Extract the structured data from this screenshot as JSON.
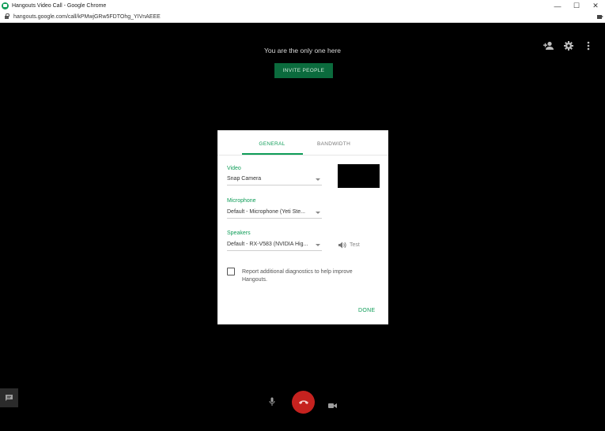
{
  "window": {
    "title": "Hangouts Video Call - Google Chrome",
    "url": "hangouts.google.com/call/kPMwjGRw5FDTOhg_YIVnAEEE",
    "minimize": "—",
    "maximize": "☐",
    "close": "✕"
  },
  "call": {
    "status": "You are the only one here",
    "invite_label": "INVITE PEOPLE"
  },
  "dialog": {
    "tabs": [
      "GENERAL",
      "BANDWIDTH"
    ],
    "active_tab": "GENERAL",
    "video": {
      "label": "Video",
      "value": "Snap Camera"
    },
    "microphone": {
      "label": "Microphone",
      "value": "Default - Microphone (Yeti Ste..."
    },
    "speakers": {
      "label": "Speakers",
      "value": "Default - RX-V583 (NVIDIA Hig...",
      "test_label": "Test"
    },
    "diagnostics": {
      "label": "Report additional diagnostics to help improve Hangouts.",
      "checked": false
    },
    "done_label": "DONE"
  },
  "colors": {
    "accent": "#0f9d58",
    "hangup": "#c5221f",
    "invite_bg": "#0b6b3d"
  },
  "icons": [
    "hangouts-app-icon",
    "lock-icon",
    "camera-icon",
    "add-person-icon",
    "gear-icon",
    "more-vert-icon",
    "chat-icon",
    "mic-icon",
    "hangup-icon",
    "video-icon",
    "speaker-icon"
  ]
}
